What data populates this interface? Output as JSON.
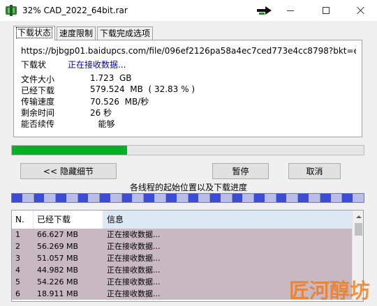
{
  "window": {
    "title": "32% CAD_2022_64bit.rar"
  },
  "tabs": [
    {
      "label": "下载状态",
      "active": true
    },
    {
      "label": "速度限制",
      "active": false
    },
    {
      "label": "下载完成选项",
      "active": false
    }
  ],
  "status": {
    "url": "https://bjbgp01.baidupcs.com/file/096ef2126pa58a4ec7ced773e4cc8798?bkt=en-06f",
    "status_label": "下载状",
    "status_value": "正在接收数据...",
    "rows": [
      {
        "label": "文件大小",
        "value": "1.723  GB"
      },
      {
        "label": "已经下载",
        "value": "579.524  MB  ( 32.83 % )"
      },
      {
        "label": "传输速度",
        "value": "70.526  MB/秒"
      },
      {
        "label": "剩余时间",
        "value": "26 秒"
      },
      {
        "label": "能否续传",
        "value": "   能够"
      }
    ]
  },
  "progress": {
    "percent": 32.83,
    "fill_color": "#06b025"
  },
  "buttons": {
    "hide_details": "<< 隐藏细节",
    "pause": "暂停",
    "cancel": "取消"
  },
  "threads": {
    "label": "各线程的起始位置以及下载进度",
    "segment_count": 16,
    "segment_progress": 0.48,
    "done_color": "#3b4cd6",
    "pending_color": "#b8bce8"
  },
  "table": {
    "headers": {
      "n": "N.",
      "downloaded": "已经下载",
      "info": "信息"
    },
    "rows": [
      {
        "n": "1",
        "downloaded": "66.627  MB",
        "info": "正在接收数据..."
      },
      {
        "n": "2",
        "downloaded": "56.269  MB",
        "info": "正在接收数据..."
      },
      {
        "n": "3",
        "downloaded": "51.057  MB",
        "info": "正在接收数据..."
      },
      {
        "n": "4",
        "downloaded": "44.982  MB",
        "info": "正在接收数据..."
      },
      {
        "n": "5",
        "downloaded": "54.226  MB",
        "info": "正在接收数据..."
      },
      {
        "n": "6",
        "downloaded": "18.911  MB",
        "info": "正在接收数据..."
      }
    ]
  },
  "watermark": "匠河醇坊"
}
